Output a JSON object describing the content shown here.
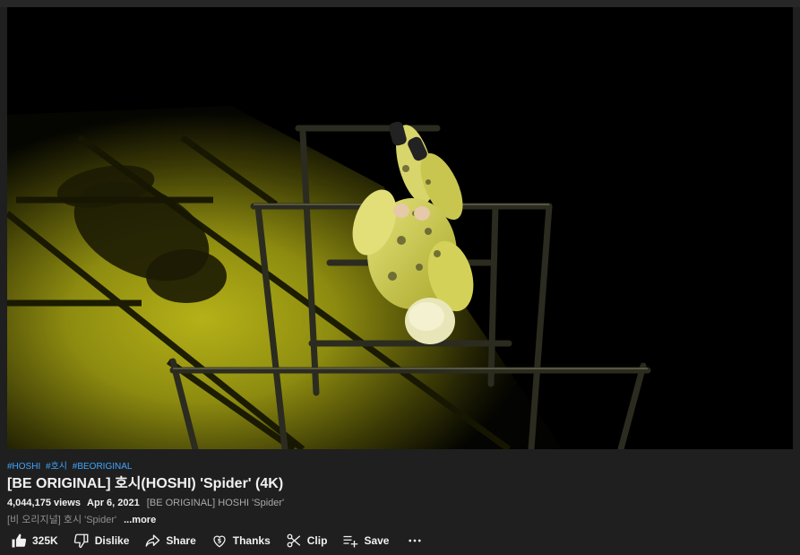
{
  "video": {
    "hashtags": [
      "#HOSHI",
      "#호시",
      "#BEORIGINAL"
    ],
    "title": "[BE ORIGINAL] 호시(HOSHI) 'Spider' (4K)",
    "views": "4,044,175 views",
    "date": "Apr 6, 2021",
    "description_head": "[BE ORIGINAL] HOSHI 'Spider'",
    "description_line2": "[비 오리지널] 호시 'Spider'",
    "more_label": "...more"
  },
  "actions": {
    "like_count": "325K",
    "dislike_label": "Dislike",
    "share_label": "Share",
    "thanks_label": "Thanks",
    "clip_label": "Clip",
    "save_label": "Save"
  },
  "icons": {
    "like": "thumbs-up-icon",
    "dislike": "thumbs-down-icon",
    "share": "share-arrow-icon",
    "thanks": "thanks-heart-dollar-icon",
    "clip": "scissors-icon",
    "save": "playlist-add-icon",
    "more": "more-horizontal-icon"
  },
  "colors": {
    "background": "#1f1f1f",
    "hashtag_link": "#3ea6ff",
    "primary_text": "#f1f1f1",
    "secondary_text": "#aaaaaa",
    "spotlight": "#9c9a12"
  }
}
